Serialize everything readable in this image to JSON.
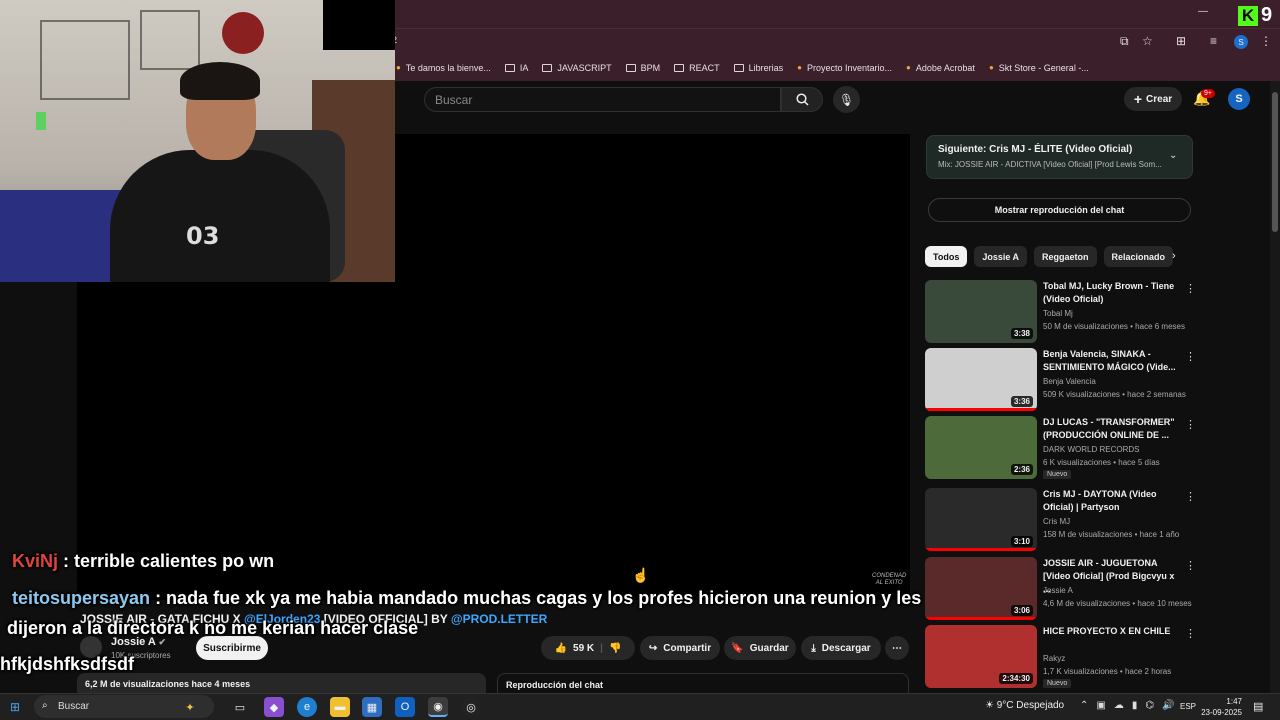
{
  "browser": {
    "tab_fragment": "2",
    "bookmarks": [
      {
        "label": "Te damos la bienve...",
        "icon": "site-icon"
      },
      {
        "label": "IA",
        "icon": "folder-icon"
      },
      {
        "label": "JAVASCRIPT",
        "icon": "folder-icon"
      },
      {
        "label": "BPM",
        "icon": "folder-icon"
      },
      {
        "label": "REACT",
        "icon": "folder-icon"
      },
      {
        "label": "Librerias",
        "icon": "folder-icon"
      },
      {
        "label": "Proyecto Inventario...",
        "icon": "site-icon"
      },
      {
        "label": "Adobe Acrobat",
        "icon": "site-icon"
      },
      {
        "label": "Skt Store - General -...",
        "icon": "site-icon"
      }
    ],
    "profile_initial": "S"
  },
  "youtube": {
    "search_placeholder": "Buscar",
    "create_label": "Crear",
    "notif_badge": "9+",
    "avatar_initial": "S",
    "video": {
      "title_part1": "JOSSIE AIR - GATA FICHU X ",
      "title_link": "@ElJorden23",
      "title_part2": " [VIDEO OFFICIAL] BY ",
      "title_link2": "@PROD.LETTER",
      "watermark_line1": "CONDENAD",
      "watermark_line2": "AL EXITO",
      "channel": "Jossie A",
      "subs": "10K suscriptores",
      "subscribe": "Suscribirme",
      "likes": "59 K",
      "share": "Compartir",
      "save": "Guardar",
      "download": "Descargar",
      "views_line": "6,2 M de visualizaciones  hace 4 meses",
      "chat_replay": "Reproducción del chat"
    },
    "sidebar": {
      "next_title": "Siguiente: Cris MJ - ÉLITE (Video Oficial)",
      "next_sub": "Mix: JOSSIE AIR - ADICTIVA [Video Oficial] [Prod Lewis Som...",
      "show_chat": "Mostrar reproducción del chat",
      "chips": [
        "Todos",
        "Jossie A",
        "Reggaeton",
        "Relacionado"
      ],
      "recs": [
        {
          "title": "Tobal MJ, Lucky Brown - Tiene (Video Oficial)",
          "channel": "Tobal Mj",
          "meta": "50 M de visualizaciones • hace 6 meses",
          "duration": "3:38",
          "badge": "",
          "color": "#3a4a3a",
          "progress": 0
        },
        {
          "title": "Benja Valencia, SINAKA - SENTIMIENTO MÁGICO (Vide...",
          "channel": "Benja Valencia",
          "meta": "509 K visualizaciones • hace 2 semanas",
          "duration": "3:36",
          "badge": "",
          "color": "#cfcfcf",
          "progress": 1
        },
        {
          "title": "DJ LUCAS - \"TRANSFORMER\" (PRODUCCIÓN ONLINE DE ...",
          "channel": "DARK WORLD RECORDS",
          "meta": "6 K visualizaciones • hace 5 días",
          "duration": "2:36",
          "badge": "Nuevo",
          "color": "#4d6a3a",
          "progress": 0
        },
        {
          "title": "Cris MJ - DAYTONA (Video Oficial) | Partyson",
          "channel": "Cris MJ",
          "meta": "158 M de visualizaciones • hace 1 año",
          "duration": "3:10",
          "badge": "",
          "color": "#2a2a2a",
          "progress": 1
        },
        {
          "title": "JOSSIE AIR - JUGUETONA [Video Oficial] (Prod Bigcvyu x ...",
          "channel": "Jossie A",
          "meta": "4,6 M de visualizaciones • hace 10 meses",
          "duration": "3:06",
          "badge": "",
          "color": "#5a2a2a",
          "progress": 1
        },
        {
          "title": "HICE PROYECTO X EN CHILE",
          "channel": "Rakyz",
          "meta": "1,7 K visualizaciones • hace 2 horas",
          "duration": "2:34:30",
          "badge": "Nuevo",
          "color": "#b03030",
          "progress": 0
        }
      ]
    }
  },
  "stream": {
    "kick_letter": "K",
    "viewer_count": "9",
    "jersey": "03",
    "chat": [
      {
        "user": "KviNj",
        "msg": " : terrible calientes po wn"
      },
      {
        "user": "teitosupersayan",
        "msg": " : nada fue xk ya me habia mandado muchas cagas y los profes hicieron una reunion y les"
      },
      {
        "user": "",
        "msg": "dijeron a la directora k no me kerian hacer clase"
      },
      {
        "user": "",
        "msg": "hfkjdshfksdfsdf"
      }
    ]
  },
  "taskbar": {
    "search": "Buscar",
    "weather": "9°C  Despejado",
    "lang": "ESP",
    "time": "1:47",
    "date": "23-09-2025"
  }
}
